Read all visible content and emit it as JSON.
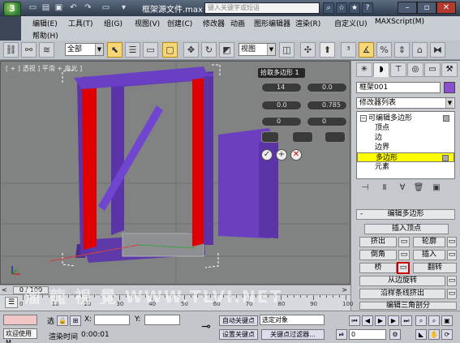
{
  "title": {
    "app_icon": "3",
    "document": "框架源文件.max",
    "search_placeholder": "键入关键字或短语"
  },
  "menu": [
    "编辑(E)",
    "工具(T)",
    "组(G)",
    "视图(V)",
    "创建(C)",
    "修改器",
    "动画",
    "图形编辑器",
    "渲染(R)",
    "自定义(U)",
    "MAXScript(M)"
  ],
  "menu_help": "帮助(H)",
  "toolbar": {
    "selection_filter": "全部",
    "ref_coord": "视图"
  },
  "viewport": {
    "label": "[ + ] 透视 ] 平滑 + 高光 ]"
  },
  "caddy": {
    "title": "拾取多边形 1",
    "fields": [
      "14",
      "0.0",
      "0.0",
      "0.785",
      "0",
      "0"
    ]
  },
  "command_panel": {
    "object_name": "框架001",
    "object_color": "#8a4fd1",
    "modifier_list": "修改器列表",
    "stack": [
      {
        "label": "可编辑多边形",
        "expand": "−"
      },
      {
        "label": "顶点"
      },
      {
        "label": "边"
      },
      {
        "label": "边界"
      },
      {
        "label": "多边形"
      },
      {
        "label": "元素"
      }
    ],
    "rollout_title": "编辑多边形",
    "rollout_collapse": "-",
    "buttons": {
      "insert_vertex": "插入顶点",
      "extrude": "挤出",
      "outline": "轮廓",
      "bevel": "倒角",
      "inset": "插入",
      "bridge": "桥",
      "flip": "翻转",
      "hinge_from_edge": "从边旋转",
      "extrude_along_spline": "沿样条线挤出",
      "edit_triangulation": "编辑三角剖分"
    }
  },
  "timeline": {
    "thumb": "0 / 100",
    "ticks": [
      "0",
      "10",
      "20",
      "30",
      "40",
      "50",
      "60",
      "70",
      "80",
      "90",
      "100"
    ]
  },
  "statusbar": {
    "welcome": "欢迎使用 M",
    "selected_short": "选",
    "x_label": "X:",
    "y_label": "Y:",
    "render_time_label": "渲染时间",
    "render_time": "0:00:01",
    "auto_key": "自动关键点",
    "set_key": "设置关键点",
    "selected_object": "选定对象",
    "key_filters": "关键点过滤器...",
    "frame": "0"
  },
  "watermark": "溜 龍 視 覺   WWW.TLVI.NET"
}
